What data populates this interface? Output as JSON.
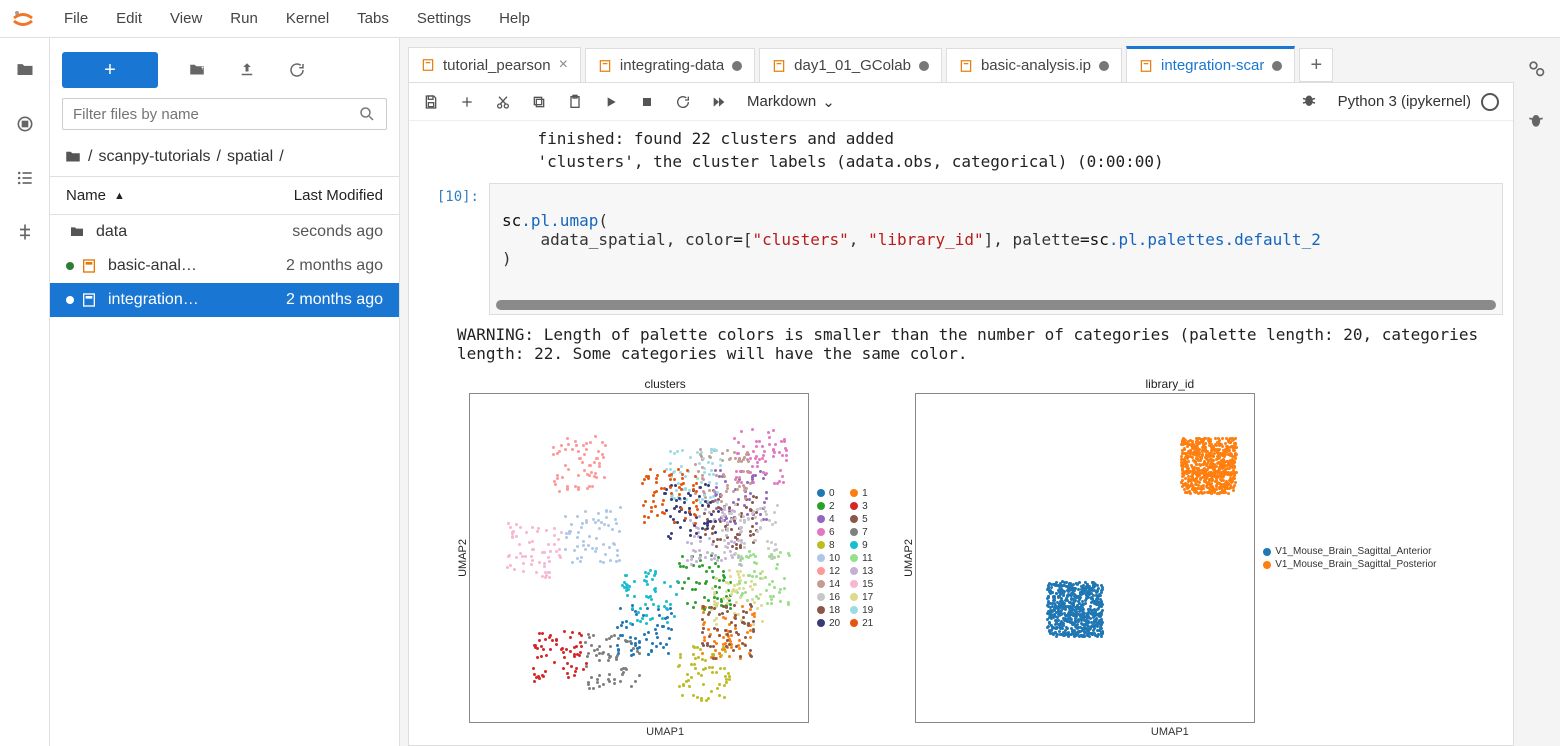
{
  "menu": {
    "items": [
      "File",
      "Edit",
      "View",
      "Run",
      "Kernel",
      "Tabs",
      "Settings",
      "Help"
    ]
  },
  "filepanel": {
    "filter_placeholder": "Filter files by name",
    "breadcrumb": [
      "/",
      "scanpy-tutorials",
      "/",
      "spatial",
      "/"
    ],
    "cols": {
      "name": "Name",
      "modified": "Last Modified"
    },
    "rows": [
      {
        "type": "dir",
        "name": "data",
        "modified": "seconds ago",
        "selected": false,
        "running": false,
        "unsaved": false
      },
      {
        "type": "nb",
        "name": "basic-anal…",
        "modified": "2 months ago",
        "selected": false,
        "running": true,
        "unsaved": false
      },
      {
        "type": "nb",
        "name": "integration…",
        "modified": "2 months ago",
        "selected": true,
        "running": false,
        "unsaved": true
      }
    ]
  },
  "tabs": [
    {
      "label": "tutorial_pearson",
      "dirty": false,
      "active": false,
      "close": true
    },
    {
      "label": "integrating-data",
      "dirty": true,
      "active": false
    },
    {
      "label": "day1_01_GColab",
      "dirty": true,
      "active": false
    },
    {
      "label": "basic-analysis.ip",
      "dirty": true,
      "active": false
    },
    {
      "label": "integration-scar",
      "dirty": true,
      "active": true
    }
  ],
  "toolbar": {
    "celltype": "Markdown",
    "kernel": "Python 3 (ipykernel)"
  },
  "output_pre": [
    "    finished: found 22 clusters and added",
    "    'clusters', the cluster labels (adata.obs, categorical) (0:00:00)"
  ],
  "cell": {
    "prompt": "[10]:",
    "line1_a": "sc",
    "line1_b": ".pl",
    "line1_c": ".umap",
    "line1_d": "(",
    "line2_a": "    adata_spatial, color",
    "line2_b": "=",
    "line2_c": "[",
    "line2_s1": "\"clusters\"",
    "line2_d": ", ",
    "line2_s2": "\"library_id\"",
    "line2_e": "], palette",
    "line2_f": "=",
    "line2_g": "sc",
    "line2_h": ".pl",
    "line2_i": ".palettes",
    "line2_j": ".default_2",
    "line3": ")"
  },
  "warning": "WARNING: Length of palette colors is smaller than the number of categories (palette length: 20, categories length: 22. Some categories will have the same color.",
  "plots": {
    "xlabel": "UMAP1",
    "ylabel": "UMAP2",
    "left": {
      "title": "clusters",
      "legend": [
        {
          "n": "0",
          "c": "#1f77b4"
        },
        {
          "n": "1",
          "c": "#ff7f0e"
        },
        {
          "n": "2",
          "c": "#2ca02c"
        },
        {
          "n": "3",
          "c": "#d62728"
        },
        {
          "n": "4",
          "c": "#9467bd"
        },
        {
          "n": "5",
          "c": "#8c564b"
        },
        {
          "n": "6",
          "c": "#e377c2"
        },
        {
          "n": "7",
          "c": "#7f7f7f"
        },
        {
          "n": "8",
          "c": "#bcbd22"
        },
        {
          "n": "9",
          "c": "#17becf"
        },
        {
          "n": "10",
          "c": "#aec7e8"
        },
        {
          "n": "11",
          "c": "#98df8a"
        },
        {
          "n": "12",
          "c": "#ff9896"
        },
        {
          "n": "13",
          "c": "#c5b0d5"
        },
        {
          "n": "14",
          "c": "#c49c94"
        },
        {
          "n": "15",
          "c": "#f7b6d2"
        },
        {
          "n": "16",
          "c": "#c7c7c7"
        },
        {
          "n": "17",
          "c": "#dbdb8d"
        },
        {
          "n": "18",
          "c": "#8c564b"
        },
        {
          "n": "19",
          "c": "#9edae5"
        },
        {
          "n": "20",
          "c": "#393b79"
        },
        {
          "n": "21",
          "c": "#e6550d"
        }
      ]
    },
    "right": {
      "title": "library_id",
      "legend": [
        {
          "n": "V1_Mouse_Brain_Sagittal_Anterior",
          "c": "#1f77b4"
        },
        {
          "n": "V1_Mouse_Brain_Sagittal_Posterior",
          "c": "#ff7f0e"
        }
      ]
    }
  }
}
